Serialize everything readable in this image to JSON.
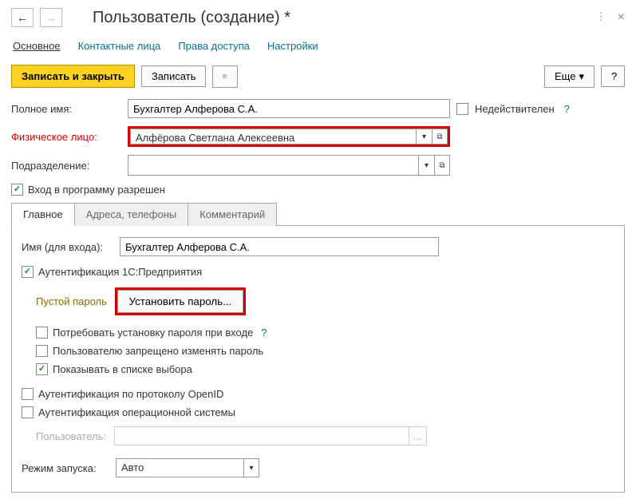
{
  "title": "Пользователь (создание) *",
  "nav_tabs": {
    "main": "Основное",
    "contacts": "Контактные лица",
    "rights": "Права доступа",
    "settings": "Настройки"
  },
  "toolbar": {
    "save_close": "Записать и закрыть",
    "save": "Записать",
    "more": "Еще",
    "help": "?"
  },
  "fields": {
    "full_name_label": "Полное имя:",
    "full_name_value": "Бухгалтер Алферова С.А.",
    "inactive_label": "Недействителен",
    "person_label": "Физическое лицо:",
    "person_value": "Алфёрова Светлана Алексеевна",
    "dept_label": "Подразделение:",
    "dept_value": "",
    "login_allowed_label": "Вход в программу разрешен"
  },
  "subtabs": {
    "main": "Главное",
    "addresses": "Адреса, телефоны",
    "comment": "Комментарий"
  },
  "panel": {
    "login_label": "Имя (для входа):",
    "login_value": "Бухгалтер Алферова С.А.",
    "auth_1c_label": "Аутентификация 1С:Предприятия",
    "empty_password": "Пустой пароль",
    "set_password": "Установить пароль...",
    "require_password_label": "Потребовать установку пароля при входе",
    "forbid_change_label": "Пользователю запрещено изменять пароль",
    "show_in_list_label": "Показывать в списке выбора",
    "auth_openid_label": "Аутентификация по протоколу OpenID",
    "auth_os_label": "Аутентификация операционной системы",
    "os_user_label": "Пользователь:",
    "launch_label": "Режим запуска:",
    "launch_value": "Авто"
  },
  "icons": {
    "dropdown": "▾",
    "open": "⧉",
    "dots": "…",
    "kebab": "⋮",
    "close": "×"
  }
}
